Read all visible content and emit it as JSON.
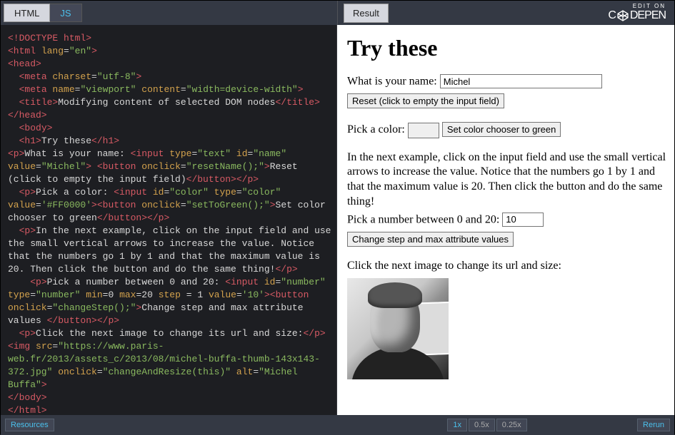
{
  "tabs": {
    "html": "HTML",
    "js": "JS",
    "result": "Result"
  },
  "brand": {
    "edit_on": "EDIT ON",
    "name_a": "C",
    "name_b": "DEPEN"
  },
  "code": {
    "l1a": "<!DOCTYPE html>",
    "l2a": "<html ",
    "l2b": "lang",
    "l2c": "=",
    "l2d": "\"en\"",
    "l2e": ">",
    "l3": "<head>",
    "l4a": "  <meta ",
    "l4b": "charset",
    "l4d": "\"utf-8\"",
    "l4e": ">",
    "l5a": "  <meta ",
    "l5b": "name",
    "l5d": "\"viewport\"",
    "l5e": " content",
    "l5g": "\"width=device-width\"",
    "l5h": ">",
    "l6a": "  <title>",
    "l6b": "Modifying content of selected DOM nodes",
    "l6c": "</title>",
    "l7": "</head>",
    "l8": "  <body>",
    "l9a": "  <h1>",
    "l9b": "Try these",
    "l9c": "</h1>",
    "l10a": "<p>",
    "l10b": "What is your name: ",
    "l10c": "<input ",
    "l10d": "type",
    "l10f": "\"text\"",
    "l10g": " id",
    "l10i": "\"name\"",
    "l11a": "value",
    "l11c": "\"Michel\"",
    "l11d": "> <button ",
    "l11e": "onclick",
    "l11g": "\"resetName();\"",
    "l11h": ">",
    "l11i": "Reset (click to empty the input field)",
    "l11j": "</button></p>",
    "l12a": "  <p>",
    "l12b": "Pick a color: ",
    "l12c": "<input ",
    "l12d": "id",
    "l12f": "\"color\"",
    "l12g": " type",
    "l12i": "\"color\"",
    "l13a": "value",
    "l13c": "'#FF0000'",
    "l13d": "><button ",
    "l13e": "onclick",
    "l13g": "\"setToGreen();\"",
    "l13h": ">",
    "l13i": "Set color chooser to green",
    "l13j": "</button></p>",
    "l14a": "  <p>",
    "l14b": "In the next example, click on the input field and use the small vertical arrows to increase the value. Notice that the numbers go 1 by 1 and that the maximum value is 20. Then click the button and do the same thing!",
    "l14c": "</p>",
    "l15a": "    <p>",
    "l15b": "Pick a number between 0 and 20: ",
    "l15c": "<input ",
    "l15d": "id",
    "l15f": "\"number\"",
    "l16a": "type",
    "l16c": "\"number\"",
    "l16d": " min",
    "l16e": "=0 ",
    "l16f": "max",
    "l16g": "=20 ",
    "l16h": "step",
    "l16i": " = 1 ",
    "l16j": "value",
    "l16l": "'10'",
    "l16m": "><button",
    "l17a": "onclick",
    "l17c": "\"changeStep();\"",
    "l17d": ">",
    "l17e": "Change step and max attribute values",
    "l17f": "</button></p>",
    "l18a": "  <p>",
    "l18b": "Click the next image to change its url and size:",
    "l18c": "</p>",
    "l19a": "<img ",
    "l19b": "src",
    "l19d": "\"https://www.paris-web.fr/2013/assets_c/2013/08/michel-buffa-thumb-143x143-372.jpg\"",
    "l19e": " onclick",
    "l19g": "\"changeAndResize(this)\"",
    "l19h": " alt",
    "l19j": "\"Michel Buffa\"",
    "l19k": ">",
    "l20": "</body>",
    "l21": "</html>"
  },
  "result": {
    "h1": "Try these",
    "name_label": "What is your name: ",
    "name_value": "Michel",
    "reset_btn": "Reset (click to empty the input field)",
    "color_label": "Pick a color: ",
    "color_btn": "Set color chooser to green",
    "desc": "In the next example, click on the input field and use the small vertical arrows to increase the value. Notice that the numbers go 1 by 1 and that the maximum value is 20. Then click the button and do the same thing!",
    "num_label": "Pick a number between 0 and 20: ",
    "num_value": "10",
    "step_btn": "Change step and max attribute values",
    "img_label": "Click the next image to change its url and size:",
    "color_value": "#FF0000"
  },
  "bottom": {
    "resources": "Resources",
    "z1": "1x",
    "z05": "0.5x",
    "z025": "0.25x",
    "rerun": "Rerun"
  }
}
